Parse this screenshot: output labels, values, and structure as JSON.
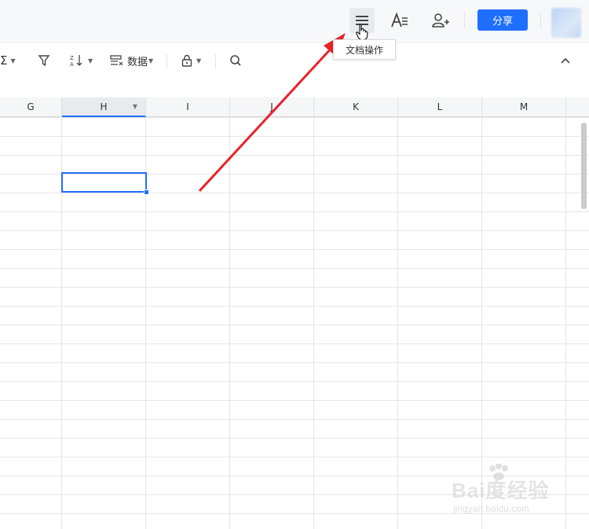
{
  "topbar": {
    "share_label": "分享",
    "menu_icon": "hamburger-menu-icon",
    "text_style_icon": "text-format-icon",
    "add_collab_icon": "add-user-icon",
    "accent": "#1e6fff"
  },
  "tooltip": {
    "text": "文档操作"
  },
  "toolbar": {
    "sum_icon": "sigma-icon",
    "filter_icon": "filter-icon",
    "sort_icon": "sort-icon",
    "data_label": "数据",
    "lock_icon": "lock-icon",
    "search_icon": "search-icon",
    "collapse_icon": "chevron-up-icon"
  },
  "columns": [
    "G",
    "H",
    "I",
    "J",
    "K",
    "L",
    "M"
  ],
  "active_column": "H",
  "watermark": {
    "brand": "Bai度经验",
    "url": "jingyan.baidu.com"
  }
}
